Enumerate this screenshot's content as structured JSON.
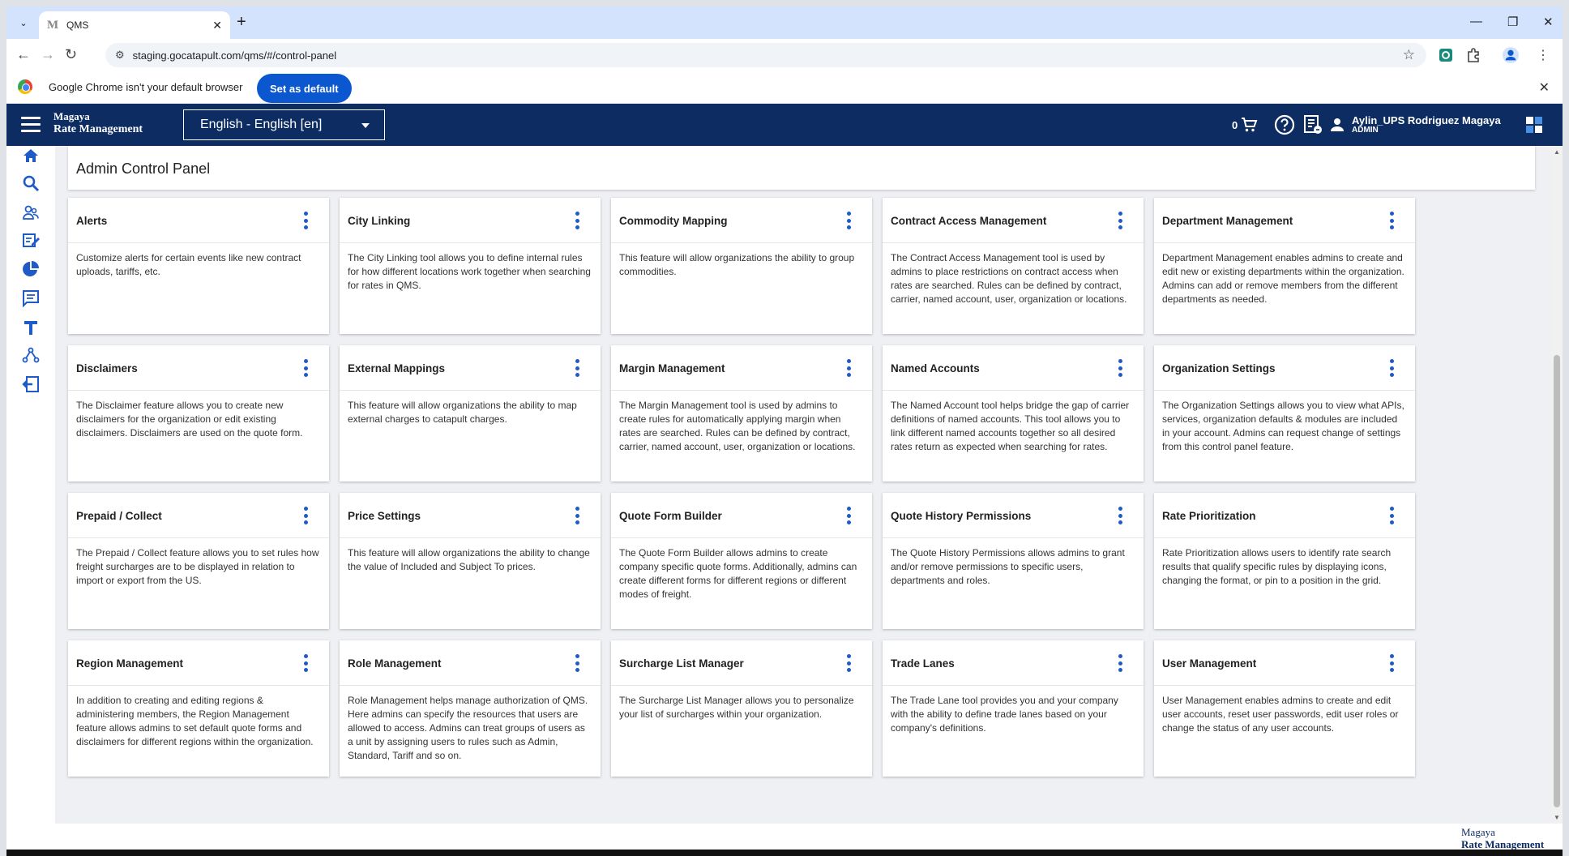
{
  "browser": {
    "tab_title": "QMS",
    "tab_favicon": "M",
    "url": "staging.gocatapult.com/qms/#/control-panel",
    "infobar_message": "Google Chrome isn't your default browser",
    "set_default_label": "Set as default"
  },
  "header": {
    "brand_line1": "Magaya",
    "brand_line2": "Rate Management",
    "language": "English - English [en]",
    "cart_count": "0",
    "user_name": "Aylin_UPS Rodriguez Magaya",
    "user_role": "ADMIN"
  },
  "page": {
    "title": "Admin Control Panel"
  },
  "cards": [
    {
      "title": "Alerts",
      "desc": "Customize alerts for certain events like new contract uploads, tariffs, etc."
    },
    {
      "title": "City Linking",
      "desc": "The City Linking tool allows you to define internal rules for how different locations work together when searching for rates in QMS."
    },
    {
      "title": "Commodity Mapping",
      "desc": "This feature will allow organizations the ability to group commodities."
    },
    {
      "title": "Contract Access Management",
      "desc": "The Contract Access Management tool is used by admins to place restrictions on contract access when rates are searched. Rules can be defined by contract, carrier, named account, user, organization or locations."
    },
    {
      "title": "Department Management",
      "desc": "Department Management enables admins to create and edit new or existing departments within the organization. Admins can add or remove members from the different departments as needed."
    },
    {
      "title": "Disclaimers",
      "desc": "The Disclaimer feature allows you to create new disclaimers for the organization or edit existing disclaimers. Disclaimers are used on the quote form."
    },
    {
      "title": "External Mappings",
      "desc": "This feature will allow organizations the ability to map external charges to catapult charges."
    },
    {
      "title": "Margin Management",
      "desc": "The Margin Management tool is used by admins to create rules for automatically applying margin when rates are searched. Rules can be defined by contract, carrier, named account, user, organization or locations."
    },
    {
      "title": "Named Accounts",
      "desc": "The Named Account tool helps bridge the gap of carrier definitions of named accounts. This tool allows you to link different named accounts together so all desired rates return as expected when searching for rates."
    },
    {
      "title": "Organization Settings",
      "desc": "The Organization Settings allows you to view what APIs, services, organization defaults & modules are included in your account. Admins can request change of settings from this control panel feature."
    },
    {
      "title": "Prepaid / Collect",
      "desc": "The Prepaid / Collect feature allows you to set rules how freight surcharges are to be displayed in relation to import or export from the US."
    },
    {
      "title": "Price Settings",
      "desc": "This feature will allow organizations the ability to change the value of Included and Subject To prices."
    },
    {
      "title": "Quote Form Builder",
      "desc": "The Quote Form Builder allows admins to create company specific quote forms. Additionally, admins can create different forms for different regions or different modes of freight."
    },
    {
      "title": "Quote History Permissions",
      "desc": "The Quote History Permissions allows admins to grant and/or remove permissions to specific users, departments and roles."
    },
    {
      "title": "Rate Prioritization",
      "desc": "Rate Prioritization allows users to identify rate search results that qualify specific rules by displaying icons, changing the format, or pin to a position in the grid."
    },
    {
      "title": "Region Management",
      "desc": "In addition to creating and editing regions & administering members, the Region Management feature allows admins to set default quote forms and disclaimers for different regions within the organization."
    },
    {
      "title": "Role Management",
      "desc": "Role Management helps manage authorization of QMS. Here admins can specify the resources that users are allowed to access. Admins can treat groups of users as a unit by assigning users to rules such as Admin, Standard, Tariff and so on."
    },
    {
      "title": "Surcharge List Manager",
      "desc": "The Surcharge List Manager allows you to personalize your list of surcharges within your organization."
    },
    {
      "title": "Trade Lanes",
      "desc": "The Trade Lane tool provides you and your company with the ability to define trade lanes based on your company's definitions."
    },
    {
      "title": "User Management",
      "desc": "User Management enables admins to create and edit user accounts, reset user passwords, edit user roles or change the status of any user accounts."
    }
  ],
  "footer": {
    "brand_line1": "Magaya",
    "brand_line2": "Rate Management"
  },
  "colors": {
    "header_bg": "#0d2d62",
    "accent": "#1e5ac8",
    "chrome_button": "#0b57d0"
  }
}
